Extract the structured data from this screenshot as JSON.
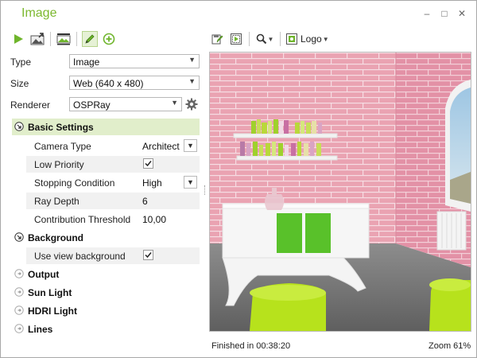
{
  "window": {
    "title": "Image"
  },
  "controls": {
    "minimize": "–",
    "maximize": "□",
    "close": "✕"
  },
  "toolbar_right": {
    "logo_label": "Logo"
  },
  "form": {
    "type": {
      "label": "Type",
      "value": "Image"
    },
    "size": {
      "label": "Size",
      "value": "Web (640 x 480)"
    },
    "renderer": {
      "label": "Renderer",
      "value": "OSPRay"
    }
  },
  "sections": {
    "basic": {
      "title": "Basic Settings"
    },
    "background": {
      "title": "Background"
    },
    "output": {
      "title": "Output"
    },
    "sun_light": {
      "title": "Sun Light"
    },
    "hdri_light": {
      "title": "HDRI Light"
    },
    "lines": {
      "title": "Lines"
    }
  },
  "basic_settings": {
    "camera_type": {
      "label": "Camera Type",
      "value": "Architect"
    },
    "low_priority": {
      "label": "Low Priority",
      "checked": true
    },
    "stopping_condition": {
      "label": "Stopping Condition",
      "value": "High"
    },
    "ray_depth": {
      "label": "Ray Depth",
      "value": "6"
    },
    "contribution_threshold": {
      "label": "Contribution Threshold",
      "value": "10,00"
    }
  },
  "background": {
    "use_view_background": {
      "label": "Use view background",
      "checked": true
    }
  },
  "status": {
    "finished": "Finished in 00:38:20",
    "zoom": "Zoom 61%"
  },
  "colors": {
    "accent": "#7cb82f",
    "section_open_bg": "#e1eecb",
    "brick": "#eaa3b2",
    "chair": "#b7e21c"
  }
}
